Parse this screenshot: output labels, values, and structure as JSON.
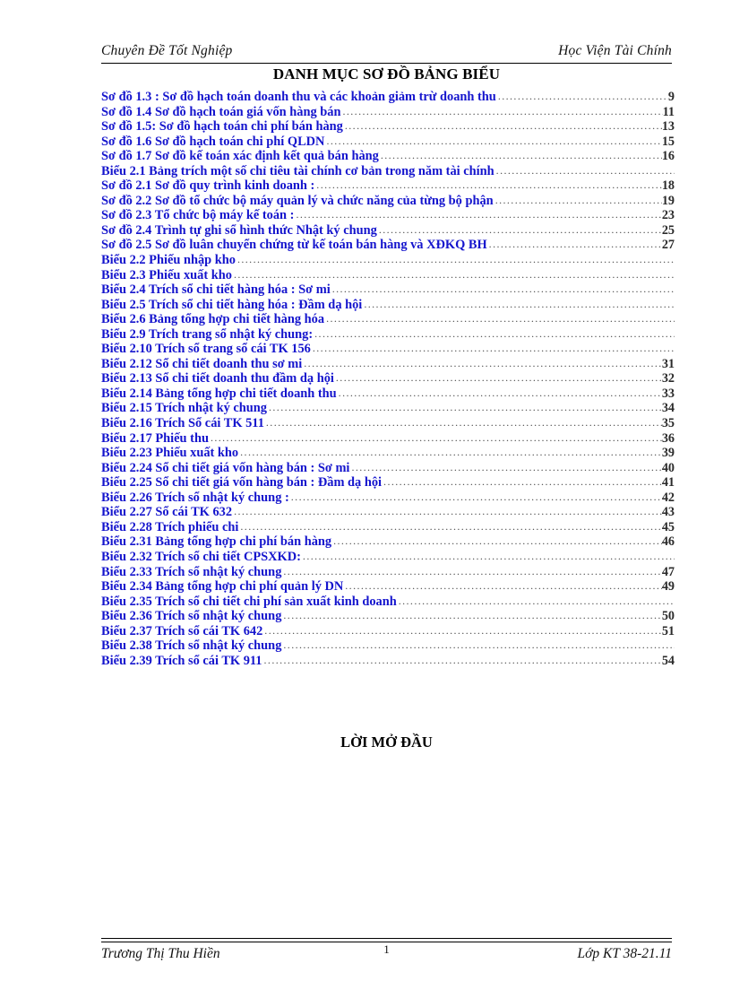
{
  "header": {
    "left": "Chuyên Đề Tốt Nghiệp",
    "right": "Học Viện Tài Chính"
  },
  "title": "DANH MỤC SƠ ĐỒ BẢNG BIỂU",
  "toc": {
    "entries": [
      {
        "label": "Sơ đồ 1.3 : Sơ đồ hạch toán doanh thu và các khoản giảm trừ doanh thu",
        "page": "9"
      },
      {
        "label": "Sơ đồ 1.4 Sơ đồ hạch toán giá vốn hàng bán",
        "page": "11"
      },
      {
        "label": "Sơ đồ 1.5: Sơ đồ hạch toán chi phí bán hàng",
        "page": "13"
      },
      {
        "label": "Sơ đồ 1.6 Sơ đồ hạch toán chi phí QLDN",
        "page": "15"
      },
      {
        "label": "Sơ đồ 1.7 Sơ đồ kế toán xác định kết quả bán hàng",
        "page": "16"
      },
      {
        "label": "Biểu 2.1 Bảng trích một số chỉ tiêu tài chính cơ bản trong năm tài chính",
        "page": ""
      },
      {
        "label": "Sơ đồ 2.1 Sơ đồ quy trình kinh doanh :",
        "page": "18"
      },
      {
        "label": "Sơ đồ 2.2 Sơ đồ tổ chức bộ máy quản lý và chức năng của từng bộ phận",
        "page": "19"
      },
      {
        "label": "Sơ đồ 2.3 Tổ chức bộ máy kế toán :",
        "page": "23"
      },
      {
        "label": "Sơ đồ 2.4 Trình tự ghi sổ hình thức Nhật ký chung",
        "page": "25"
      },
      {
        "label": "Sơ đồ 2.5 Sơ đồ luân chuyển chứng từ  kế toán bán hàng và XĐKQ BH",
        "page": "27"
      },
      {
        "label": "Biểu 2.2 Phiếu nhập kho",
        "page": ""
      },
      {
        "label": "Biểu 2.3 Phiếu xuất kho",
        "page": ""
      },
      {
        "label": "Biểu 2.4 Trích  sổ chi tiết hàng hóa : Sơ mi",
        "page": ""
      },
      {
        "label": "Biểu 2.5 Trích  sổ chi tiết hàng hóa : Đầm dạ hội",
        "page": ""
      },
      {
        "label": "Biểu 2.6 Bảng tổng hợp chi tiết hàng hóa",
        "page": ""
      },
      {
        "label": "Biểu 2.9 Trích  trang sổ nhật ký chung:",
        "page": ""
      },
      {
        "label": "Biểu 2.10 Trích  sổ trang sổ cái TK 156",
        "page": ""
      },
      {
        "label": "Biểu 2.12 Sổ chi tiết doanh thu sơ mi",
        "page": "31"
      },
      {
        "label": "Biểu 2.13 Sổ chi tiết doanh thu đầm dạ hội",
        "page": "32"
      },
      {
        "label": "Biểu 2.14 Bảng tổng hợp chi tiết doanh thu",
        "page": "33"
      },
      {
        "label": "Biểu 2.15  Trích  nhật ký chung",
        "page": "34"
      },
      {
        "label": "Biểu 2.16 Trích  Sổ cái TK 511",
        "page": "35"
      },
      {
        "label": "Biểu 2.17 Phiếu thu",
        "page": "36"
      },
      {
        "label": "Biểu 2.23 Phiếu  xuất kho",
        "page": "39"
      },
      {
        "label": "Biểu 2.24 Sổ chi tiết giá vốn hàng bán : Sơ mi",
        "page": "40"
      },
      {
        "label": " Biểu 2.25 Sổ chi tiết giá vốn hàng bán : Đầm dạ hội",
        "page": "41"
      },
      {
        "label": "Biểu 2.26 Trích  sổ nhật ký chung :",
        "page": "42"
      },
      {
        "label": "Biểu 2.27 Sổ cái TK 632",
        "page": "43"
      },
      {
        "label": "Biểu 2.28 Trích  phiếu chi",
        "page": "45"
      },
      {
        "label": "Biểu 2.31 Bảng tổng hợp chi phí bán hàng",
        "page": "46"
      },
      {
        "label": "Biểu 2.32 Trích  sổ chi tiết CPSXKD:",
        "page": ""
      },
      {
        "label": "Biểu 2.33 Trích  sổ nhật ký chung",
        "page": "47"
      },
      {
        "label": "Biểu 2.34 Bảng tổng hợp chi phí quản lý DN",
        "page": "49"
      },
      {
        "label": "Biểu 2.35 Trích  sổ chi tiết chi phí sản xuất kinh doanh",
        "page": ""
      },
      {
        "label": "Biểu 2.36 Trích  sổ nhật ký chung",
        "page": "50"
      },
      {
        "label": "Biểu 2.37 Trích  sổ cái TK 642",
        "page": "51"
      },
      {
        "label": "Biểu 2.38 Trích  sổ nhật ký chung",
        "page": ""
      },
      {
        "label": "Biểu 2.39 Trích  sổ cái TK 911",
        "page": "54"
      }
    ]
  },
  "section_heading": "LỜI MỞ ĐẦU",
  "footer": {
    "left": "Trương Thị Thu Hiền",
    "page_number": "1",
    "right": "Lớp KT 38-21.11"
  },
  "colors": {
    "toc_entry_text": "#1414cd",
    "page_number_text": "#2b2b2b",
    "leader_dots": "#4a4a4a",
    "body_text": "#000000",
    "page_background": "#ffffff"
  }
}
